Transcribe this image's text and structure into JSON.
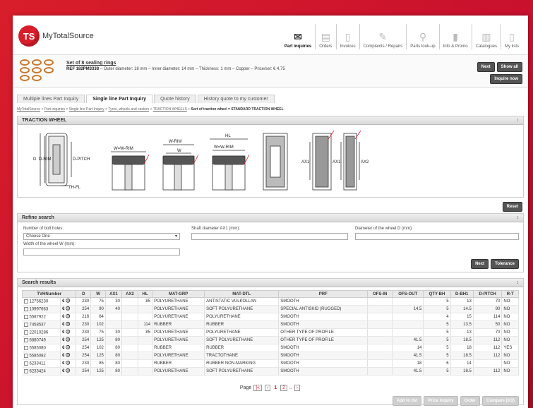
{
  "header": {
    "logo_mark": "TS",
    "logo_text": "MyTotalSource",
    "nav": [
      {
        "label": "Part inquiries",
        "icon": "envelope-icon",
        "glyph": "✉",
        "active": true
      },
      {
        "label": "Orders",
        "icon": "orders-icon",
        "glyph": "▤"
      },
      {
        "label": "Invoices",
        "icon": "invoices-icon",
        "glyph": "▯"
      },
      {
        "label": "Complaints / Repairs",
        "icon": "complaints-icon",
        "glyph": "✎"
      },
      {
        "label": "Parts look-up",
        "icon": "search-icon",
        "glyph": "⚲"
      },
      {
        "label": "Info & Promo",
        "icon": "bar-chart-icon",
        "glyph": "▮"
      },
      {
        "label": "Catalogues",
        "icon": "catalogue-icon",
        "glyph": "▥"
      },
      {
        "label": "My lists",
        "icon": "list-icon",
        "glyph": "▯"
      }
    ]
  },
  "product": {
    "title": "Set of 8 sealing rings",
    "ref_label": "REF 182PM3338",
    "desc": " – Outer diameter: 18 mm – Inner diameter: 14 mm – Thickness: 1 mm – Copper – Price/set: € 4,75",
    "next_label": "Next",
    "show_all_label": "Show all",
    "inquire_label": "Inquire now"
  },
  "tabs": [
    {
      "label": "Multiple lines Part Inquiry",
      "active": false
    },
    {
      "label": "Single line Part Inquiry",
      "active": true
    },
    {
      "label": "Quote history",
      "active": false
    },
    {
      "label": "History quote to my customer",
      "active": false
    }
  ],
  "breadcrumb": {
    "links": [
      "MyTotalSource",
      "Part inquiries",
      "Single line Part Inquiry",
      "Tyres, wheels and castors",
      "TRACTION WHEELS"
    ],
    "current": "Sort of traction wheel = STANDARD TRACTION WHEEL"
  },
  "traction": {
    "title": "TRACTION WHEEL",
    "toggle": "↕",
    "labels": {
      "d": "D",
      "d_rim": "D-RIM",
      "d_pitch": "D-PITCH",
      "th_fl": "TH-FL",
      "w_rim": "W=W-RIM",
      "w_rim2": "W-RIM",
      "w": "W",
      "hl": "HL",
      "w_rim3": "W=W-RIM",
      "ax1": "AX1",
      "ax1b": "AX1",
      "ax2": "AX2"
    },
    "reset_label": "Reset"
  },
  "refine": {
    "title": "Refine search",
    "toggle": "↕",
    "bolt_label": "Number of bolt holes:",
    "bolt_value": "Choose One",
    "shaft_label": "Shaft diameter AX1 (mm):",
    "diam_label": "Diameter of the wheel D (mm):",
    "width_label": "Width of the wheel W (mm):",
    "next_label": "Next",
    "tolerance_label": "Tolerance"
  },
  "results": {
    "title": "Search results",
    "toggle": "↕",
    "columns": [
      "TVHNumber",
      "D",
      "W",
      "AX1",
      "AX2",
      "HL",
      "MAT-GRP",
      "MAT-DTL",
      "PRF",
      "OFS-IN",
      "OFS-OUT",
      "QTY-BH",
      "D-BH1",
      "D-PITCH",
      "R-T"
    ],
    "rows": [
      [
        "12756230",
        "230",
        "75",
        "30",
        "",
        "85",
        "POLYURETHANE",
        "ANTISTATIC VULKOLLAN",
        "SMOOTH",
        "",
        "",
        "5",
        "13",
        "70",
        "NO"
      ],
      [
        "10997663",
        "254",
        "90",
        "40",
        "",
        "",
        "POLYURETHANE",
        "SOFT POLYURETHANE",
        "SPECIAL ANTISKID (RUGGED)",
        "",
        "14.5",
        "5",
        "14.5",
        "90",
        "NO"
      ],
      [
        "5587922",
        "216",
        "64",
        "",
        "",
        "",
        "POLYURETHANE",
        "POLYURETHANE",
        "SMOOTH",
        "",
        "",
        "4",
        "15",
        "114",
        "NO"
      ],
      [
        "7458537",
        "230",
        "102",
        "",
        "",
        "114",
        "RUBBER",
        "RUBBER",
        "SMOOTH",
        "",
        "",
        "5",
        "13.5",
        "50",
        "NO"
      ],
      [
        "22010286",
        "230",
        "75",
        "30",
        "",
        "85",
        "POLYURETHANE",
        "POLYURETHANE",
        "OTHER TYPE OF PROFILE",
        "",
        "",
        "5",
        "13",
        "70",
        "NO"
      ],
      [
        "6880749",
        "254",
        "125",
        "80",
        "",
        "",
        "POLYURETHANE",
        "SOFT POLYURETHANE",
        "OTHER TYPE OF PROFILE",
        "",
        "41.5",
        "5",
        "18.5",
        "112",
        "NO"
      ],
      [
        "5585080",
        "254",
        "102",
        "80",
        "",
        "",
        "RUBBER",
        "RUBBER",
        "SMOOTH",
        "",
        "14",
        "5",
        "18",
        "112",
        "YES"
      ],
      [
        "5585082",
        "254",
        "125",
        "80",
        "",
        "",
        "POLYURETHANE",
        "TRACTOTHANE",
        "SMOOTH",
        "",
        "41.5",
        "5",
        "18.5",
        "112",
        "NO"
      ],
      [
        "6233411",
        "230",
        "85",
        "80",
        "",
        "",
        "RUBBER",
        "RUBBER NON-MARKING",
        "SMOOTH",
        "",
        "18",
        "6",
        "14",
        "",
        "NO"
      ],
      [
        "6233424",
        "254",
        "125",
        "80",
        "",
        "",
        "POLYURETHANE",
        "SOFT POLYURETHANE",
        "SMOOTH",
        "",
        "41.5",
        "5",
        "18.5",
        "112",
        "NO"
      ]
    ],
    "row_icons": "€ 🛈",
    "page_label": "Page",
    "pages": [
      "1",
      "2",
      ".."
    ],
    "first_nav": "|«",
    "prev_nav": "‹",
    "next_nav": "›",
    "actions": [
      "Add to list",
      "Price inquiry",
      "Order",
      "Compare (0/3)"
    ]
  }
}
